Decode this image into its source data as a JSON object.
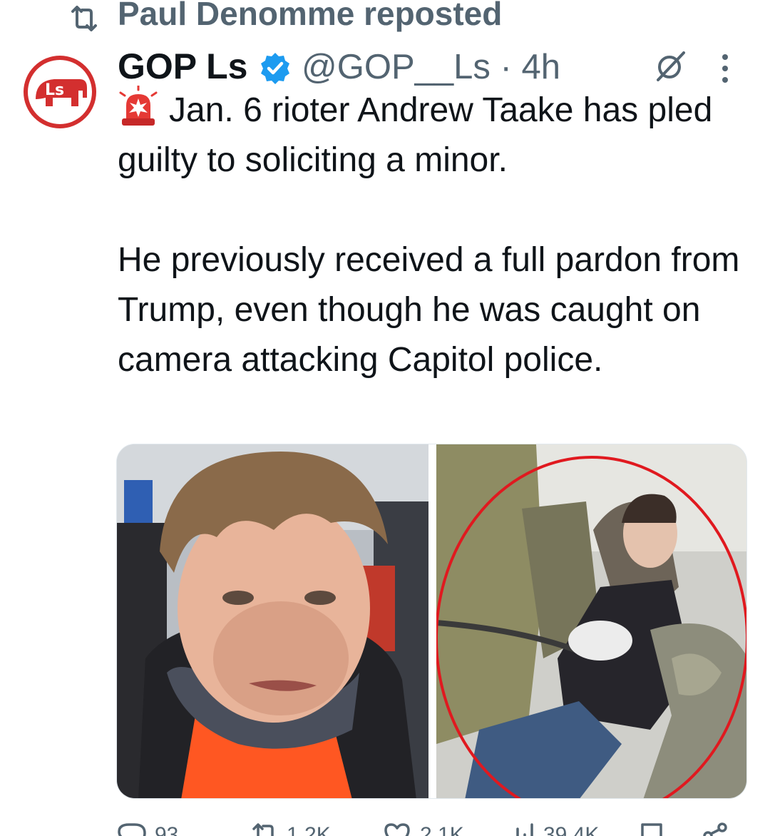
{
  "repost": {
    "icon": "repost-icon",
    "text": "Paul Denomme reposted"
  },
  "author": {
    "avatar_icon": "gop-ls-logo",
    "avatar_text": "Ls",
    "display_name": "GOP Ls",
    "verified_icon": "verified-badge-icon",
    "handle_time": "@GOP__Ls · 4h"
  },
  "tweet": {
    "emoji_icon": "police-light-siren-icon",
    "line_1": "Jan. 6 rioter Andrew Taake has pled guilty to soliciting a minor.",
    "line_2": "He previously received a full pardon from Trump, even though he was caught on camera attacking Capitol police."
  },
  "media": [
    {
      "icon": "photo-face-closeup"
    },
    {
      "icon": "photo-crowd-circled"
    }
  ],
  "actions": {
    "reply_count": "93",
    "repost_count": "1.2K",
    "like_count": "2.1K",
    "views_count": "39.4K"
  },
  "colors": {
    "text": "#0f1419",
    "muted": "#536471",
    "verified": "#1d9bf0",
    "brand_red": "#d32f2f"
  }
}
